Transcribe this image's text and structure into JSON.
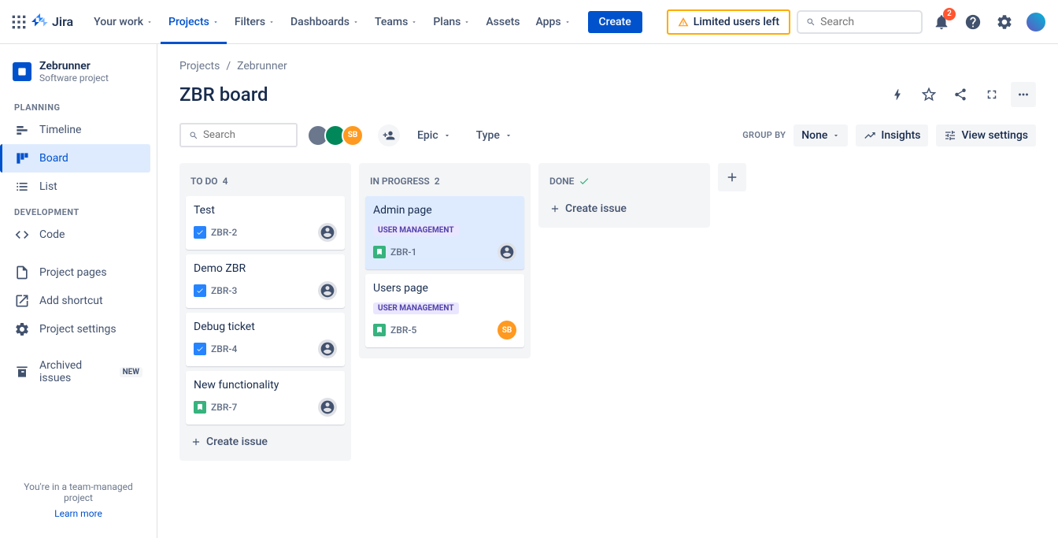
{
  "topnav": {
    "logo_text": "Jira",
    "items": [
      {
        "label": "Your work",
        "active": false
      },
      {
        "label": "Projects",
        "active": true
      },
      {
        "label": "Filters",
        "active": false
      },
      {
        "label": "Dashboards",
        "active": false
      },
      {
        "label": "Teams",
        "active": false
      },
      {
        "label": "Plans",
        "active": false
      },
      {
        "label": "Assets",
        "active": false,
        "no_chevron": true
      },
      {
        "label": "Apps",
        "active": false
      }
    ],
    "create_label": "Create",
    "warning_label": "Limited users left",
    "search_placeholder": "Search",
    "notification_count": "2"
  },
  "sidebar": {
    "project_name": "Zebrunner",
    "project_type": "Software project",
    "sections": {
      "planning": "Planning",
      "development": "Development"
    },
    "items": {
      "timeline": "Timeline",
      "board": "Board",
      "list": "List",
      "code": "Code",
      "project_pages": "Project pages",
      "add_shortcut": "Add shortcut",
      "project_settings": "Project settings",
      "archived_issues": "Archived issues"
    },
    "new_badge": "NEW",
    "footer_text": "You're in a team-managed project",
    "footer_link": "Learn more"
  },
  "breadcrumb": {
    "projects": "Projects",
    "project_name": "Zebrunner"
  },
  "board_title": "ZBR board",
  "filters": {
    "search_placeholder": "Search",
    "epic_label": "Epic",
    "type_label": "Type",
    "group_by_label": "GROUP BY",
    "group_by_value": "None",
    "insights_label": "Insights",
    "view_settings_label": "View settings"
  },
  "avatars": [
    {
      "bg": "#6b778c",
      "initials": ""
    },
    {
      "bg": "#00875a",
      "initials": ""
    },
    {
      "bg": "#ff991f",
      "initials": "SB"
    }
  ],
  "columns": [
    {
      "name": "TO DO",
      "count": "4",
      "cards": [
        {
          "title": "Test",
          "key": "ZBR-2",
          "type": "task",
          "assignee": "unassigned"
        },
        {
          "title": "Demo ZBR",
          "key": "ZBR-3",
          "type": "task",
          "assignee": "unassigned"
        },
        {
          "title": "Debug ticket",
          "key": "ZBR-4",
          "type": "task",
          "assignee": "unassigned"
        },
        {
          "title": "New functionality",
          "key": "ZBR-7",
          "type": "story",
          "assignee": "unassigned"
        }
      ],
      "show_create": true
    },
    {
      "name": "IN PROGRESS",
      "count": "2",
      "cards": [
        {
          "title": "Admin page",
          "key": "ZBR-1",
          "type": "story",
          "label": "USER MANAGEMENT",
          "assignee": "unassigned",
          "highlighted": true
        },
        {
          "title": "Users page",
          "key": "ZBR-5",
          "type": "story",
          "label": "USER MANAGEMENT",
          "assignee": "SB"
        }
      ]
    },
    {
      "name": "DONE",
      "done": true,
      "cards": [],
      "show_create": true
    }
  ],
  "create_issue_label": "Create issue"
}
